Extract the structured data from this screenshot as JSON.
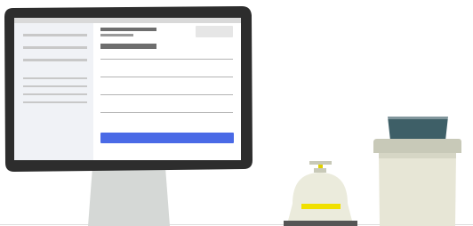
{
  "illustration": {
    "subject": "computer-monitor-with-service-bell-and-cup",
    "colors": {
      "monitor_frame": "#2d2d2d",
      "screen_background": "#ffffff",
      "sidebar_background": "#f0f2f6",
      "sidebar_lines": "#c8c8c8",
      "topbar": "#d9d9d9",
      "heading_bars": "#6e6e6e",
      "placeholder_button": "#e6e6e6",
      "form_lines": "#b4b4b4",
      "primary_button": "#4a6ae6",
      "stand": "#d5d8d6",
      "bell_body": "#ebebdc",
      "bell_band": "#f0e000",
      "bell_base": "#555555",
      "cup_body": "#e7e6d6",
      "cup_lid": "#c8c9b8",
      "cup_top": "#3e5f67",
      "floor_line": "#dcdcdc"
    }
  }
}
